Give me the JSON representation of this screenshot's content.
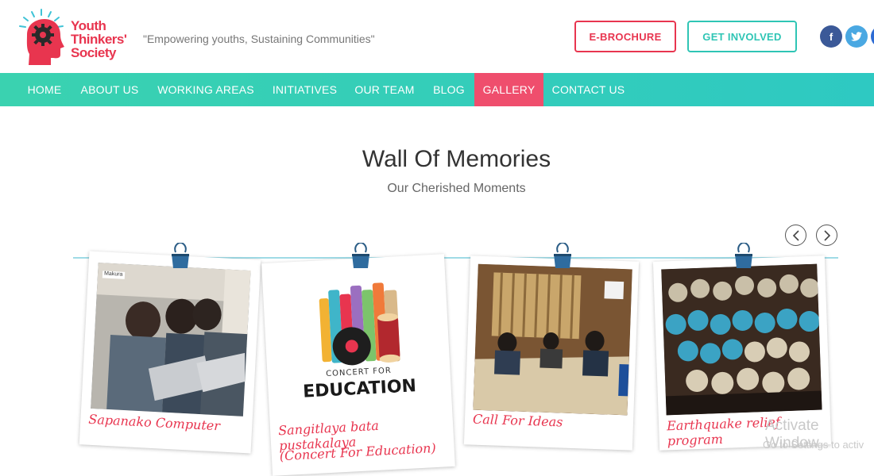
{
  "header": {
    "logo_lines": [
      "Youth",
      "Thinkers'",
      "Society"
    ],
    "tagline": "\"Empowering youths, Sustaining Communities\"",
    "brochure_label": "E-BROCHURE",
    "involved_label": "GET INVOLVED",
    "social": {
      "facebook": "f",
      "twitter": "t",
      "googleplus": "g"
    }
  },
  "nav": {
    "items": [
      "HOME",
      "ABOUT US",
      "WORKING AREAS",
      "INITIATIVES",
      "OUR TEAM",
      "BLOG",
      "GALLERY",
      "CONTACT US"
    ],
    "active": "GALLERY"
  },
  "gallery": {
    "title": "Wall Of Memories",
    "subtitle": "Our Cherished Moments",
    "photos": [
      {
        "caption": "Sapanako Computer",
        "badge": "Makura"
      },
      {
        "caption_line1": "Sangitlaya bata pustakalaya",
        "caption_line2": "(Concert For Education)",
        "poster_top": "CONCERT FOR",
        "poster_bottom": "EDUCATION"
      },
      {
        "caption": "Call For Ideas"
      },
      {
        "caption": "Earthquake relief program"
      }
    ]
  },
  "watermark": {
    "line1": "Activate Window",
    "line2": "Go to Settings to activ"
  },
  "colors": {
    "brand_red": "#e8354f",
    "teal": "#2fc5b5",
    "nav_active": "#ef4e6d"
  }
}
